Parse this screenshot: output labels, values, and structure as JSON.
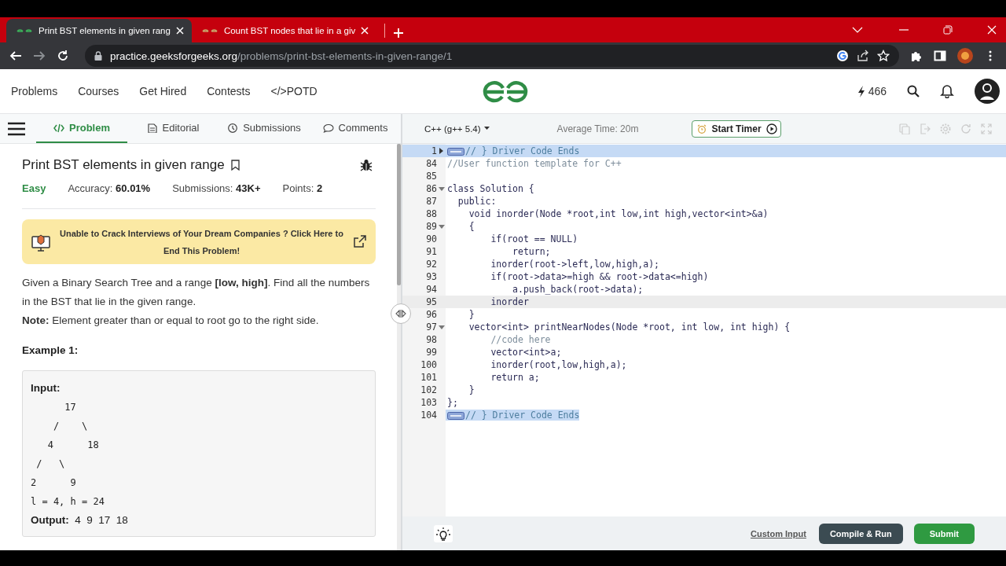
{
  "browser": {
    "tabs": [
      {
        "title": "Print BST elements in given rang",
        "selected": true
      },
      {
        "title": "Count BST nodes that lie in a giv",
        "selected": false
      }
    ],
    "url_host": "practice.geeksforgeeks.org",
    "url_path": "/problems/print-bst-elements-in-given-range/1"
  },
  "site_header": {
    "nav": [
      "Problems",
      "Courses",
      "Get Hired",
      "Contests",
      "</>POTD"
    ],
    "streak": "466"
  },
  "problem": {
    "tabs": [
      {
        "label": "Problem",
        "selected": true
      },
      {
        "label": "Editorial",
        "selected": false
      },
      {
        "label": "Submissions",
        "selected": false
      },
      {
        "label": "Comments",
        "selected": false
      }
    ],
    "title": "Print BST elements in given range",
    "difficulty": "Easy",
    "stats": [
      {
        "label": "Accuracy:",
        "value": "60.01%"
      },
      {
        "label": "Submissions:",
        "value": "43K+"
      },
      {
        "label": "Points:",
        "value": "2"
      }
    ],
    "banner": "Unable to Crack Interviews of Your Dream Companies ? Click Here to End This Problem!",
    "description": [
      "Given a Binary Search Tree and a range **[low, high]**. Find all the numbers in the BST that lie in the given range.",
      "**Note:** Element greater than or equal to root go to the right side."
    ],
    "example_title": "Example 1:",
    "example_input_label": "Input:",
    "example_lines": [
      "      17",
      "    /    \\",
      "   4      18",
      " /   \\",
      "2      9",
      "l = 4, h = 24"
    ],
    "example_output": "**Output:**  4  9  17  18"
  },
  "editor": {
    "language": "C++ (g++ 5.4)",
    "average_time": "Average Time: 20m",
    "timer_button": "Start Timer",
    "lines": [
      {
        "number": "1",
        "text": "// } Driver Code Ends",
        "kind": "driver",
        "foldable": true,
        "collapsed": true,
        "selected": true,
        "current": false
      },
      {
        "number": "84",
        "text": "//User function template for C++",
        "kind": "comment",
        "foldable": false,
        "collapsed": false,
        "selected": false,
        "current": false
      },
      {
        "number": "85",
        "kind": "code",
        "foldable": false,
        "collapsed": false,
        "selected": false,
        "current": false
      },
      {
        "number": "86",
        "text": "class Solution {",
        "kind": "code",
        "foldable": true,
        "collapsed": false,
        "selected": false,
        "current": false
      },
      {
        "number": "87",
        "text": "  public:",
        "kind": "code",
        "foldable": false,
        "collapsed": false,
        "selected": false,
        "current": false
      },
      {
        "number": "88",
        "text": "    void inorder(Node *root,int low,int high,vector<int>&a)",
        "kind": "code",
        "foldable": false,
        "collapsed": false,
        "selected": false,
        "current": false
      },
      {
        "number": "89",
        "text": "    {",
        "kind": "code",
        "foldable": true,
        "collapsed": false,
        "selected": false,
        "current": false
      },
      {
        "number": "90",
        "text": "        if(root == NULL)",
        "kind": "code",
        "foldable": false,
        "collapsed": false,
        "selected": false,
        "current": false
      },
      {
        "number": "91",
        "text": "            return;",
        "kind": "code",
        "foldable": false,
        "collapsed": false,
        "selected": false,
        "current": false
      },
      {
        "number": "92",
        "text": "        inorder(root->left,low,high,a);",
        "kind": "code",
        "foldable": false,
        "collapsed": false,
        "selected": false,
        "current": false
      },
      {
        "number": "93",
        "text": "        if(root->data>=high && root->data<=high)",
        "kind": "code",
        "foldable": false,
        "collapsed": false,
        "selected": false,
        "current": false
      },
      {
        "number": "94",
        "text": "            a.push_back(root->data);",
        "kind": "code",
        "foldable": false,
        "collapsed": false,
        "selected": false,
        "current": false
      },
      {
        "number": "95",
        "text": "        inorder",
        "kind": "code",
        "foldable": false,
        "collapsed": false,
        "selected": false,
        "current": true
      },
      {
        "number": "96",
        "text": "    }",
        "kind": "code",
        "foldable": false,
        "collapsed": false,
        "selected": false,
        "current": false
      },
      {
        "number": "97",
        "text": "    vector<int> printNearNodes(Node *root, int low, int high) {",
        "kind": "code",
        "foldable": true,
        "collapsed": false,
        "selected": false,
        "current": false
      },
      {
        "number": "98",
        "text": "        //code here",
        "kind": "comment",
        "foldable": false,
        "collapsed": false,
        "selected": false,
        "current": false
      },
      {
        "number": "99",
        "text": "        vector<int>a;",
        "kind": "code",
        "foldable": false,
        "collapsed": false,
        "selected": false,
        "current": false
      },
      {
        "number": "100",
        "text": "        inorder(root,low,high,a);",
        "kind": "code",
        "foldable": false,
        "collapsed": false,
        "selected": false,
        "current": false
      },
      {
        "number": "101",
        "text": "        return a;",
        "kind": "code",
        "foldable": false,
        "collapsed": false,
        "selected": false,
        "current": false
      },
      {
        "number": "102",
        "text": "    }",
        "kind": "code",
        "foldable": false,
        "collapsed": false,
        "selected": false,
        "current": false
      },
      {
        "number": "103",
        "text": "};",
        "kind": "code",
        "foldable": false,
        "collapsed": false,
        "selected": false,
        "current": false
      },
      {
        "number": "104",
        "text": "// } Driver Code Ends",
        "kind": "driver",
        "foldable": false,
        "collapsed": false,
        "selected": true,
        "current": false
      }
    ],
    "custom_input": "Custom Input",
    "compile_button": "Compile & Run",
    "submit_button": "Submit"
  }
}
